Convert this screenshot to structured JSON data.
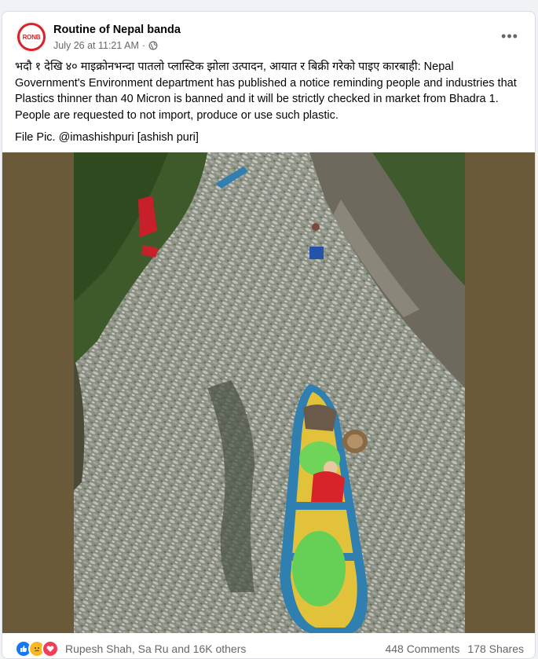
{
  "post": {
    "page_name": "Routine of Nepal banda",
    "avatar_text": "RONB",
    "date": "July 26 at 11:21 AM",
    "separator": "·",
    "more_label": "•••",
    "caption": "भदौ १ देखि ४० माइक्रोनभन्दा पातलो प्लास्टिक झोला उत्पादन, आयात र बिक्री गरेको पाइए कारबाही: Nepal Government's Environment department has published a notice reminding people and industries that Plastics thinner than 40 Micron is banned and it will be strictly checked in market from Bhadra 1. People are requested to not import, produce or use such plastic.",
    "credit": "File Pic. @imashishpuri [ashish puri]"
  },
  "reactions": {
    "icons": [
      "like-icon",
      "sad-icon",
      "love-icon"
    ],
    "names": "Rupesh Shah, Sa Ru and 16K others",
    "comments": "448 Comments",
    "shares": "178 Shares"
  },
  "colors": {
    "brand_red": "#d8232a",
    "like_blue": "#1877f2",
    "sad_yellow": "#f7b928",
    "love_red": "#f33e58",
    "secondary_text": "#65676b"
  }
}
